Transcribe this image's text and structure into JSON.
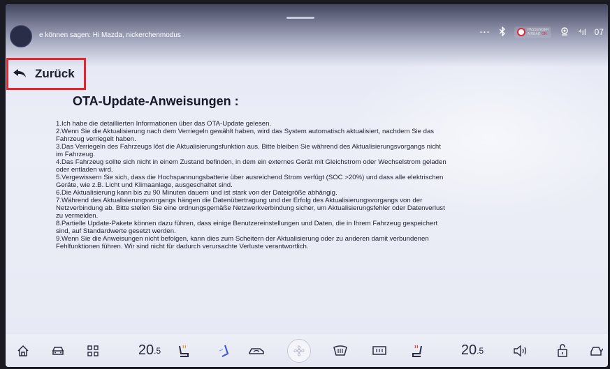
{
  "status": {
    "voice_hint": "e können sagen: Hi Mazda, nickerchenmodus",
    "voice_hint_tail": "‹",
    "more": "···",
    "airbag_label_top": "PASSENGER",
    "airbag_label_bottom": "AIRBAG",
    "airbag_state": "ON",
    "signal": "⁴ıl",
    "clock": "07"
  },
  "nav": {
    "back_label": "Zurück"
  },
  "content": {
    "title": "OTA-Update-Anweisungen :",
    "lines": [
      "1.Ich habe die detaillierten Informationen über das OTA-Update gelesen.",
      "2.Wenn Sie die Aktualisierung nach dem Verriegeln gewählt haben, wird das System automatisch aktualisiert, nachdem Sie das",
      "Fahrzeug verriegelt haben.",
      "3.Das Verriegeln des Fahrzeugs löst die Aktualisierungsfunktion aus. Bitte bleiben Sie während des Aktualisierungsvorgangs nicht",
      "im Fahrzeug.",
      "4.Das Fahrzeug sollte sich nicht in einem Zustand befinden, in dem ein externes Gerät mit Gleichstrom oder Wechselstrom geladen",
      "oder entladen wird.",
      "5.Vergewissern Sie sich, dass die Hochspannungsbatterie über ausreichend Strom verfügt (SOC >20%) und dass alle elektrischen",
      "Geräte, wie z.B. Licht und Klimaanlage, ausgeschaltet sind.",
      "6.Die Aktualisierung kann bis zu 90 Minuten dauern und ist stark von der Dateigröße abhängig.",
      "7.Während des Aktualisierungsvorgangs hängen die Datenübertragung und der Erfolg des Aktualisierungsvorgangs von der",
      "Netzverbindung ab. Bitte stellen Sie eine ordnungsgemäße Netzwerkverbindung sicher, um Aktualisierungsfehler oder Datenverlust",
      "zu vermeiden.",
      "8.Partielle Update-Pakete können dazu führen, dass einige Benutzereinstellungen und Daten, die in Ihrem Fahrzeug gespeichert",
      "sind, auf Standardwerte gesetzt werden.",
      "9.Wenn Sie die Anweisungen nicht befolgen, kann dies zum Scheitern der Aktualisierung oder zu anderen damit verbundenen",
      "Fehlfunktionen führen. Wir sind nicht für dadurch verursachte Verluste verantwortlich."
    ]
  },
  "bottom_bar": {
    "temp_left_main": "20",
    "temp_left_dec": ".5",
    "temp_right_main": "20",
    "temp_right_dec": ".5",
    "icons": [
      "home-icon",
      "car-icon",
      "apps-grid-icon",
      "seat-heat-left-icon",
      "airflow-seat-icon",
      "recirculation-icon",
      "fan-icon",
      "front-defrost-icon",
      "rear-defrost-icon",
      "seat-heat-right-icon",
      "volume-icon",
      "unlock-icon",
      "car-door-icon"
    ],
    "accent_color": "#3b4fd8"
  }
}
